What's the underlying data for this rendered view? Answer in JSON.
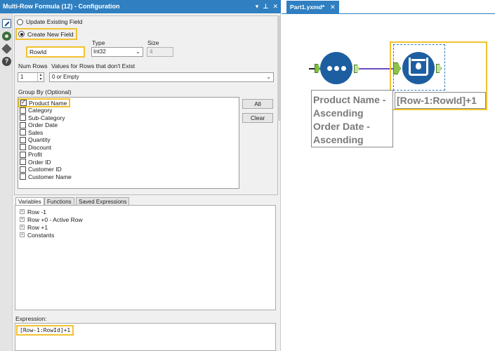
{
  "config_panel": {
    "title": "Multi-Row Formula (12) - Configuration",
    "title_controls": {
      "dropdown_glyph": "▾",
      "pin_glyph": "⊥",
      "close_glyph": "✕"
    },
    "sidebar_icons": [
      "wrench-icon",
      "gear-icon",
      "tag-icon",
      "help-icon"
    ],
    "help_glyph": "?"
  },
  "field_mode": {
    "update_label": "Update Existing Field",
    "create_label": "Create New  Field",
    "selected": "create"
  },
  "new_field": {
    "name_value": "RowId",
    "type_label": "Type",
    "type_value": "Int32",
    "size_label": "Size",
    "size_value": "4"
  },
  "num_rows": {
    "label": "Num Rows",
    "value": "1",
    "values_label": "Values for Rows that don't Exist",
    "values_selected": "0 or Empty"
  },
  "group_by": {
    "label": "Group By (Optional)",
    "items": [
      {
        "label": "Product Name",
        "checked": true
      },
      {
        "label": "Category",
        "checked": false
      },
      {
        "label": "Sub-Category",
        "checked": false
      },
      {
        "label": "Order Date",
        "checked": false
      },
      {
        "label": "Sales",
        "checked": false
      },
      {
        "label": "Quantity",
        "checked": false
      },
      {
        "label": "Discount",
        "checked": false
      },
      {
        "label": "Profit",
        "checked": false
      },
      {
        "label": "Order ID",
        "checked": false
      },
      {
        "label": "Customer ID",
        "checked": false
      },
      {
        "label": "Customer Name",
        "checked": false
      }
    ],
    "all_button": "All",
    "clear_button": "Clear"
  },
  "tabs": {
    "variables": "Variables",
    "functions": "Functions",
    "saved": "Saved Expressions",
    "active": "variables"
  },
  "variables_tree": {
    "expander_glyph": "+",
    "items": [
      "Row -1",
      "Row +0 - Active Row",
      "Row +1",
      "Constants"
    ]
  },
  "expression": {
    "label": "Expression:",
    "value": "[Row-1:RowId]+1"
  },
  "canvas": {
    "tab_title": "Part1.yxmd*",
    "tab_close_glyph": "✕",
    "sort_annotation": [
      "Product Name -",
      "Ascending",
      "Order Date -",
      "Ascending"
    ],
    "multirow_annotation": "[Row-1:RowId]+1"
  },
  "colors": {
    "accent": "#2f7fc1",
    "highlight": "#f2c230",
    "tool_blue": "#1d5ea1",
    "anchor_green": "#8ec34a",
    "connection_purple": "#6a4ac2"
  }
}
